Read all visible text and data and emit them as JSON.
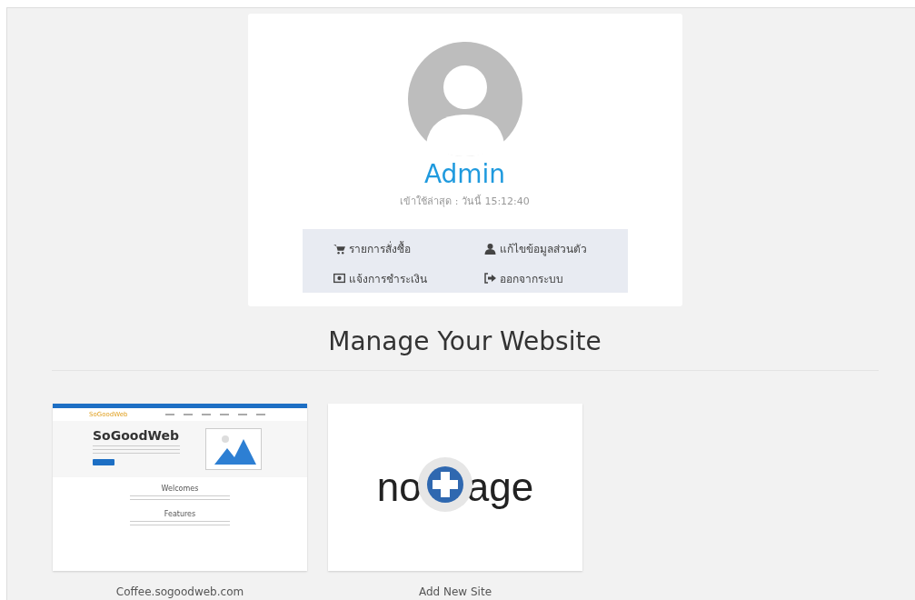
{
  "profile": {
    "name": "Admin",
    "last_login": "เข้าใช้ล่าสุด : วันนี้ 15:12:40"
  },
  "menu": [
    {
      "kind": "cart",
      "label": "รายการสั่งซื้อ"
    },
    {
      "kind": "user",
      "label": "แก้ไขข้อมูลส่วนตัว"
    },
    {
      "kind": "money",
      "label": "แจ้งการชำระเงิน"
    },
    {
      "kind": "signout",
      "label": "ออกจากระบบ"
    }
  ],
  "heading": "Manage Your Website",
  "sites": [
    {
      "kind": "thumbnail",
      "caption": "Coffee.sogoodweb.com",
      "preview": {
        "logo": "SoGoodWeb",
        "hero_title": "SoGoodWeb",
        "sections": [
          "Welcomes",
          "Features"
        ]
      }
    },
    {
      "kind": "add",
      "caption": "Add New Site",
      "image_text": [
        "no",
        "age"
      ]
    }
  ]
}
